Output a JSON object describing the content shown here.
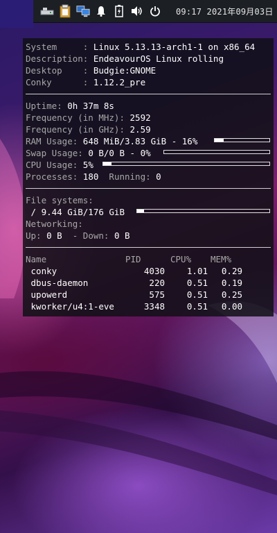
{
  "topbar": {
    "clock": "09:17  2021年09月03日",
    "icons": [
      "storage-icon",
      "clipboard-icon",
      "network-icon",
      "notification-bell-icon",
      "battery-icon",
      "volume-icon",
      "power-icon",
      "logout-icon"
    ]
  },
  "conky": {
    "system": [
      {
        "label": "System     : ",
        "value": "Linux 5.13.13-arch1-1 on x86_64"
      },
      {
        "label": "Description: ",
        "value": "EndeavourOS Linux rolling"
      },
      {
        "label": "Desktop    : ",
        "value": "Budgie:GNOME"
      },
      {
        "label": "Conky      : ",
        "value": "1.12.2_pre"
      }
    ],
    "uptime": {
      "label": "Uptime: ",
      "value": "0h 37m 8s"
    },
    "freq_mhz": {
      "label": "Frequency (in MHz): ",
      "value": "2592"
    },
    "freq_ghz": {
      "label": "Frequency (in GHz): ",
      "value": "2.59"
    },
    "ram": {
      "label": "RAM Usage: ",
      "value": "648 MiB/3.83 GiB - 16%",
      "percent": 0.16
    },
    "swap": {
      "label": "Swap Usage: ",
      "value": "0 B/0 B - 0%",
      "percent": 0.0
    },
    "cpu": {
      "label": "CPU Usage: ",
      "value": "5%",
      "percent": 0.05
    },
    "processes": {
      "label": "Processes: ",
      "value": "180",
      "running_label": "  Running: ",
      "running_value": "0"
    },
    "filesystems": {
      "label": "File systems:",
      "mount": " / ",
      "value": "9.44 GiB/176 GiB",
      "percent": 0.054
    },
    "networking": {
      "label": "Networking:",
      "up_label": "Up: ",
      "up_value": "0 B",
      "down_label": "  - Down: ",
      "down_value": "0 B"
    },
    "proc_table": {
      "headers": [
        "Name",
        "PID",
        "CPU%",
        "MEM%"
      ],
      "rows": [
        [
          " conky",
          "4030",
          "1.01",
          "0.29"
        ],
        [
          " dbus-daemon",
          "220",
          "0.51",
          "0.19"
        ],
        [
          " upowerd",
          "575",
          "0.51",
          "0.25"
        ],
        [
          " kworker/u4:1-eve",
          "3348",
          "0.51",
          "0.00"
        ]
      ]
    }
  }
}
